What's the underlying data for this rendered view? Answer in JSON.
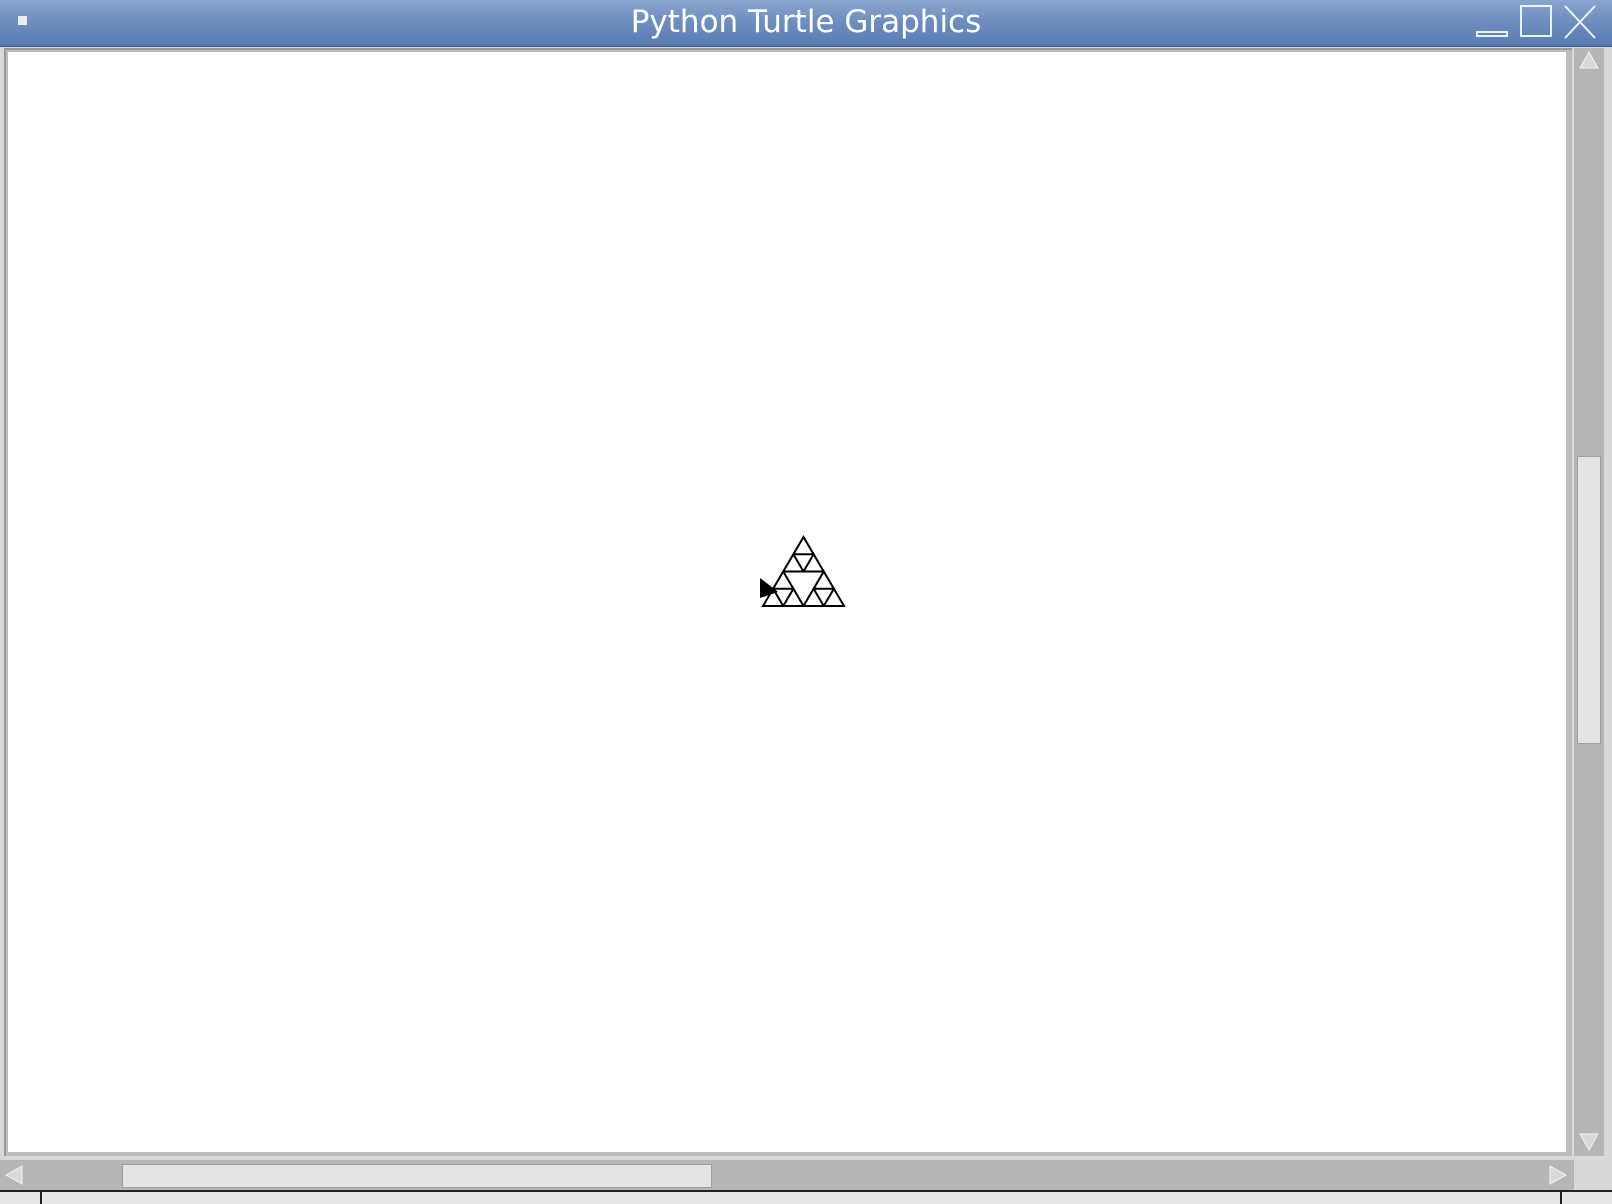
{
  "window": {
    "title": "Python Turtle Graphics",
    "menu_icon": "window-menu-icon",
    "minimize_icon": "minimize-icon",
    "maximize_icon": "maximize-icon",
    "close_icon": "close-icon"
  },
  "canvas": {
    "background": "#ffffff",
    "drawing": "sierpinski-triangle",
    "pen_color": "#000000",
    "turtle_icon": "turtle-arrow-icon"
  },
  "scrollbars": {
    "vertical": {
      "position": 0.33,
      "visible_fraction": 0.26
    },
    "horizontal": {
      "position": 0.08,
      "visible_fraction": 0.37
    }
  },
  "colors": {
    "titlebar": "#6f8fc1",
    "scroll_track": "#b6b6b6",
    "scroll_thumb": "#e4e4e4"
  }
}
